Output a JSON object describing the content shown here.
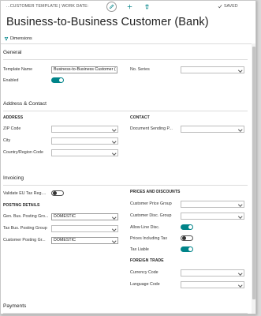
{
  "header": {
    "breadcrumb": "...CUSTOMER TEMPLATE | WORK DATE:",
    "saved": "SAVED"
  },
  "page_title": "Business-to-Business Customer (Bank)",
  "actions": {
    "dimensions": "Dimensions"
  },
  "general": {
    "title": "General",
    "template_name_label": "Template Name",
    "template_name_value": "Business-to-Business Customer (",
    "enabled_label": "Enabled",
    "enabled": true,
    "no_series_label": "No. Series",
    "no_series_value": ""
  },
  "address": {
    "title": "Address & Contact",
    "address_heading": "ADDRESS",
    "zip_label": "ZIP Code",
    "city_label": "City",
    "country_label": "Country/Region Code",
    "contact_heading": "CONTACT",
    "doc_sending_label": "Document Sending P..."
  },
  "invoicing": {
    "title": "Invoicing",
    "validate_label": "Validate EU Tax Reg....",
    "validate": false,
    "posting_heading": "POSTING DETAILS",
    "gen_bus_label": "Gen. Bus. Posting Gro...",
    "gen_bus_value": "DOMESTIC",
    "tax_bus_label": "Tax Bus. Posting Group",
    "tax_bus_value": "",
    "cust_posting_label": "Customer Posting Gr...",
    "cust_posting_value": "DOMESTIC",
    "prices_heading": "PRICES AND DISCOUNTS",
    "price_group_label": "Customer Price Group",
    "disc_group_label": "Customer Disc. Group",
    "allow_line_label": "Allow Line Disc.",
    "allow_line": true,
    "prices_incl_label": "Prices Including Tax",
    "prices_incl": false,
    "tax_liable_label": "Tax Liable",
    "tax_liable": true,
    "foreign_heading": "FOREIGN TRADE",
    "currency_label": "Currency Code",
    "language_label": "Language Code"
  },
  "payments": {
    "title": "Payments"
  },
  "colors": {
    "accent": "#008489"
  }
}
